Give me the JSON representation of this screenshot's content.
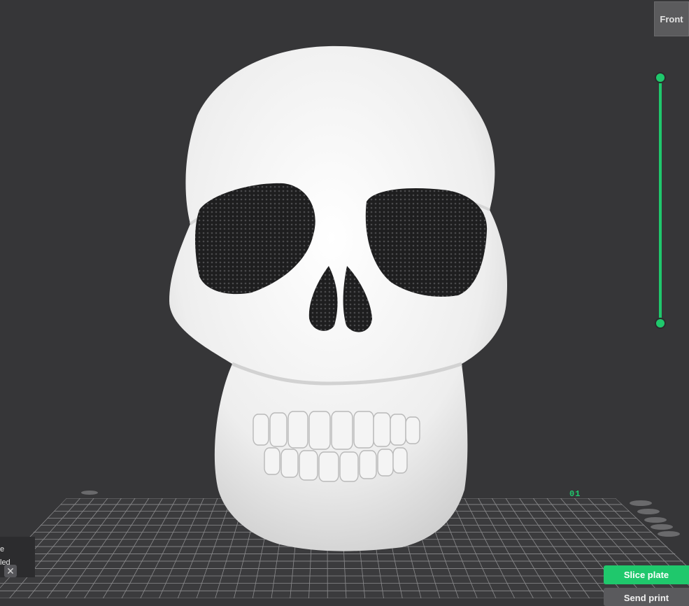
{
  "viewport": {
    "background": "#363638",
    "model_name": "skull"
  },
  "view_cube": {
    "label": "Front"
  },
  "layer_slider": {
    "color": "#1fc86c"
  },
  "plate": {
    "label": "01"
  },
  "notification": {
    "line1": "e",
    "line2": "led",
    "close_icon": "close-icon"
  },
  "actions": {
    "slice_label": "Slice plate",
    "send_label": "Send print",
    "accent": "#1fc86c"
  }
}
